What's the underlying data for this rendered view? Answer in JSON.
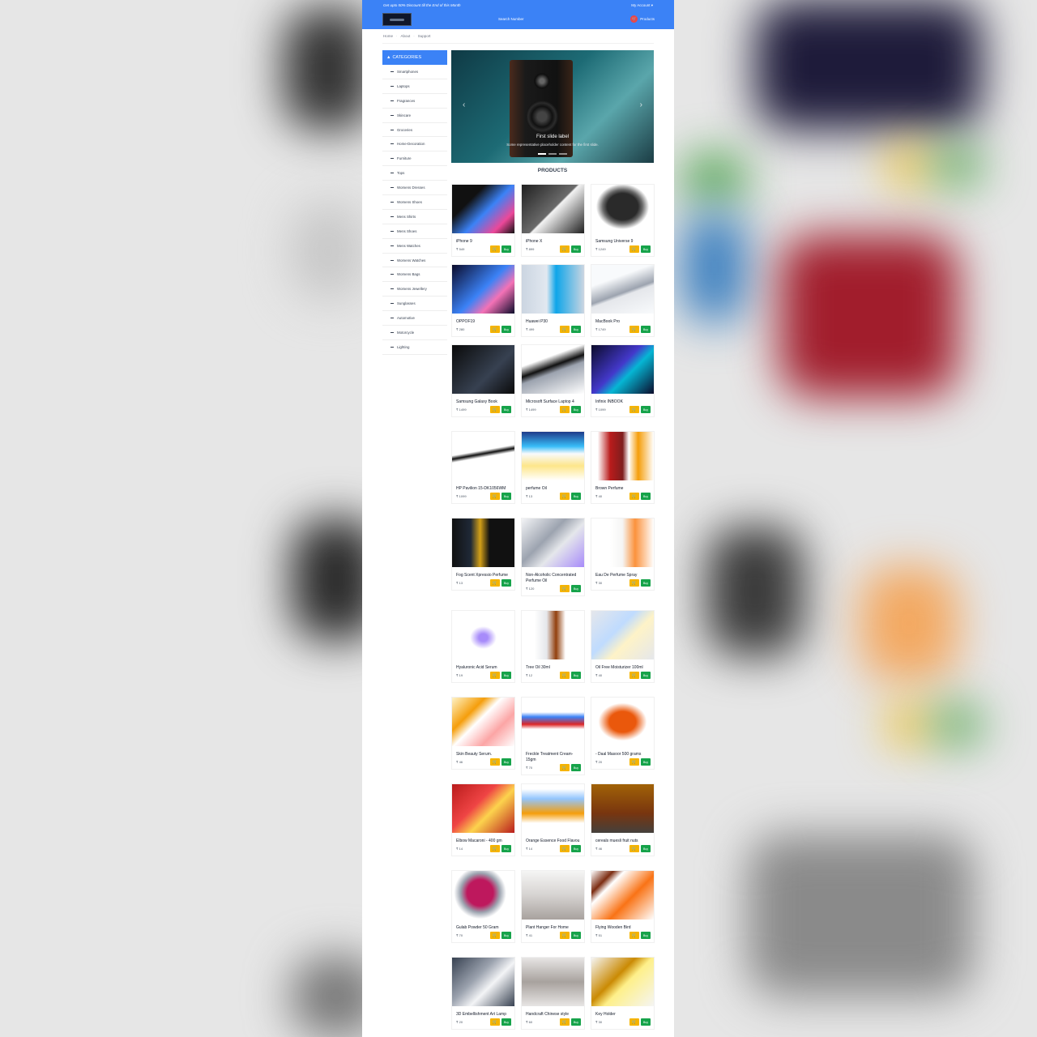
{
  "topbar": {
    "promo": "Get upto 50% Discount till the End of this Month",
    "account": "My Account ▾",
    "search": "Search Number",
    "cart_label": "Products",
    "cart_icon": "cart-icon"
  },
  "breadcrumb": [
    "Home",
    "About",
    "Support"
  ],
  "sidebar": {
    "header": "CATEGORIES",
    "items": [
      "Smartphones",
      "Laptops",
      "Fragrances",
      "Skincare",
      "Groceries",
      "Home-Decoration",
      "Furniture",
      "Tops",
      "Womens Dresses",
      "Womens Shoes",
      "Mens Shirts",
      "Mens Shoes",
      "Mens Watches",
      "Womens Watches",
      "Womens Bags",
      "Womens Jewellery",
      "Sunglasses",
      "Automotive",
      "Motorcycle",
      "Lighting"
    ]
  },
  "carousel": {
    "title": "First slide label",
    "text": "Some representative placeholder content for the first slide.",
    "prev_icon": "chevron-left-icon",
    "next_icon": "chevron-right-icon"
  },
  "products_title": "PRODUCTS",
  "buttons": {
    "cart_icon": "🛒",
    "buy": "Buy"
  },
  "products": [
    {
      "name": "iPhone 9",
      "price": "₹ 549"
    },
    {
      "name": "iPhone X",
      "price": "₹ 899"
    },
    {
      "name": "Samsung Universe 9",
      "price": "₹ 1249"
    },
    {
      "name": "OPPOF19",
      "price": "₹ 280"
    },
    {
      "name": "Huawei P30",
      "price": "₹ 499"
    },
    {
      "name": "MacBook Pro",
      "price": "₹ 1749"
    },
    {
      "name": "Samsung Galaxy Book",
      "price": "₹ 1499"
    },
    {
      "name": "Microsoft Surface Laptop 4",
      "price": "₹ 1499"
    },
    {
      "name": "Infinix INBOOK",
      "price": "₹ 1099"
    },
    {
      "name": "HP Pavilion 15-DK1056WM",
      "price": "₹ 1099"
    },
    {
      "name": "perfume Oil",
      "price": "₹ 13"
    },
    {
      "name": "Brown Perfume",
      "price": "₹ 40"
    },
    {
      "name": "Fog Scent Xpressio Perfume",
      "price": "₹ 13"
    },
    {
      "name": "Non-Alcoholic Concentrated Perfume Oil",
      "price": "₹ 120"
    },
    {
      "name": "Eau De Perfume Spray",
      "price": "₹ 30"
    },
    {
      "name": "Hyaluronic Acid Serum",
      "price": "₹ 19"
    },
    {
      "name": "Tree Oil 30ml",
      "price": "₹ 12"
    },
    {
      "name": "Oil Free Moisturizer 100ml",
      "price": "₹ 40"
    },
    {
      "name": "Skin Beauty Serum.",
      "price": "₹ 46"
    },
    {
      "name": "Freckle Treatment Cream- 15gm",
      "price": "₹ 70"
    },
    {
      "name": "- Daal Masoor 500 grams",
      "price": "₹ 20"
    },
    {
      "name": "Elbow Macaroni - 400 gm",
      "price": "₹ 14"
    },
    {
      "name": "Orange Essence Food Flavou",
      "price": "₹ 14"
    },
    {
      "name": "cereals muesli fruit nuts",
      "price": "₹ 46"
    },
    {
      "name": "Gulab Powder 50 Gram",
      "price": "₹ 70"
    },
    {
      "name": "Plant Hanger For Home",
      "price": "₹ 41"
    },
    {
      "name": "Flying Wooden Bird",
      "price": "₹ 51"
    },
    {
      "name": "3D Embellishment Art Lamp",
      "price": "₹ 20"
    },
    {
      "name": "Handcraft Chinese style",
      "price": "₹ 60"
    },
    {
      "name": "Key Holder",
      "price": "₹ 30"
    }
  ]
}
